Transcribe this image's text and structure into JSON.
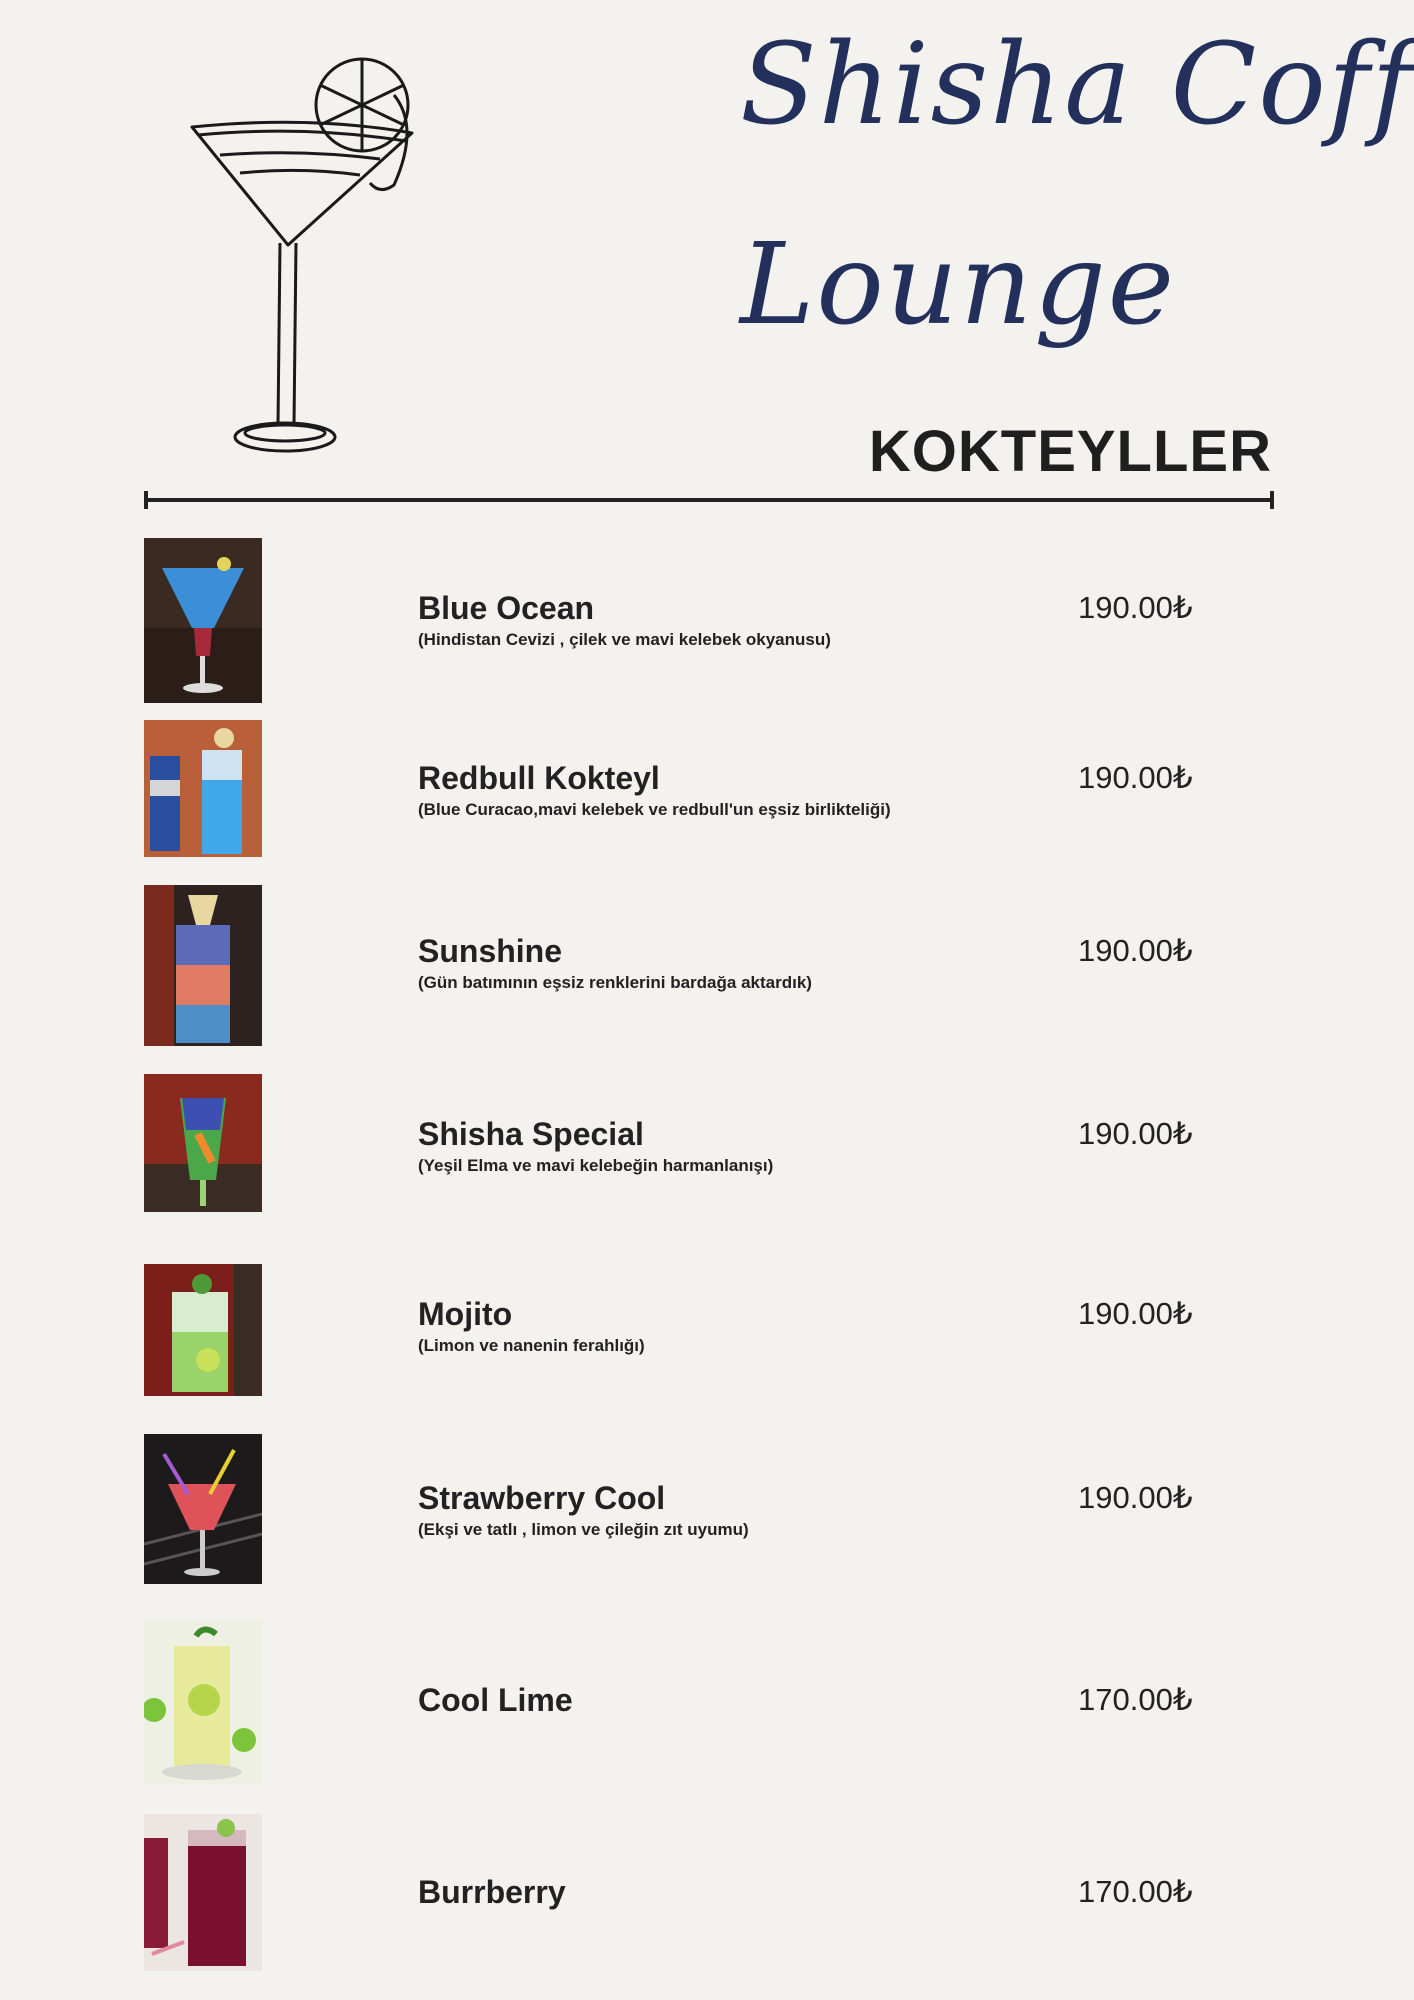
{
  "header": {
    "title_line1": "Shisha Coffe",
    "title_line2": "Lounge",
    "section": "KOKTEYLLER",
    "icon": "cocktail-glass-icon"
  },
  "colors": {
    "title": "#23305c",
    "background": "#f3f2ee",
    "text": "#1f1f1f"
  },
  "items": [
    {
      "name": "Blue Ocean",
      "description": "(Hindistan Cevizi , çilek ve mavi kelebek okyanusu)",
      "price": "190.00₺",
      "photo": "blue-ocean-photo"
    },
    {
      "name": "Redbull Kokteyl",
      "description": "(Blue Curacao,mavi kelebek ve redbull'un eşsiz birlikteliği)",
      "price": "190.00₺",
      "photo": "redbull-kokteyl-photo"
    },
    {
      "name": "Sunshine",
      "description": "(Gün batımının eşsiz renklerini bardağa aktardık)",
      "price": "190.00₺",
      "photo": "sunshine-photo"
    },
    {
      "name": "Shisha Special",
      "description": "(Yeşil Elma ve mavi kelebeğin harmanlanışı)",
      "price": "190.00₺",
      "photo": "shisha-special-photo"
    },
    {
      "name": "Mojito",
      "description": "(Limon ve nanenin ferahlığı)",
      "price": "190.00₺",
      "photo": "mojito-photo"
    },
    {
      "name": "Strawberry Cool",
      "description": "(Ekşi ve tatlı , limon ve çileğin zıt uyumu)",
      "price": "190.00₺",
      "photo": "strawberry-cool-photo"
    },
    {
      "name": "Cool Lime",
      "description": "",
      "price": "170.00₺",
      "photo": "cool-lime-photo"
    },
    {
      "name": "Burrberry",
      "description": "",
      "price": "170.00₺",
      "photo": "burrberry-photo"
    }
  ]
}
